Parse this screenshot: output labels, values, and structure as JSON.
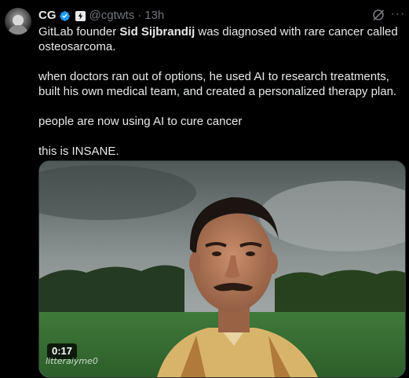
{
  "tweet": {
    "display_name": "CG",
    "handle": "@cgtwts",
    "separator": "·",
    "time": "13h",
    "paragraphs": {
      "p1_before": "GitLab founder ",
      "p1_bold": "Sid Sijbrandij",
      "p1_after": " was diagnosed with rare cancer called osteosarcoma.",
      "p2": "when doctors ran out of options, he used AI to research treatments, built his own medical team, and created a personalized therapy plan.",
      "p3": "people are now using AI to cure cancer",
      "p4": "this is INSANE."
    },
    "media": {
      "duration": "0:17",
      "watermark": "litteraiyme0"
    },
    "more_label": "···"
  },
  "icons": {
    "verified": "verified-badge-icon",
    "affiliation": "affiliation-badge-icon",
    "grok": "grok-icon",
    "more": "more-options-icon"
  },
  "colors": {
    "background": "#000000",
    "text_primary": "#e7e9ea",
    "text_secondary": "#71767b",
    "verified_blue": "#1d9bf0"
  }
}
